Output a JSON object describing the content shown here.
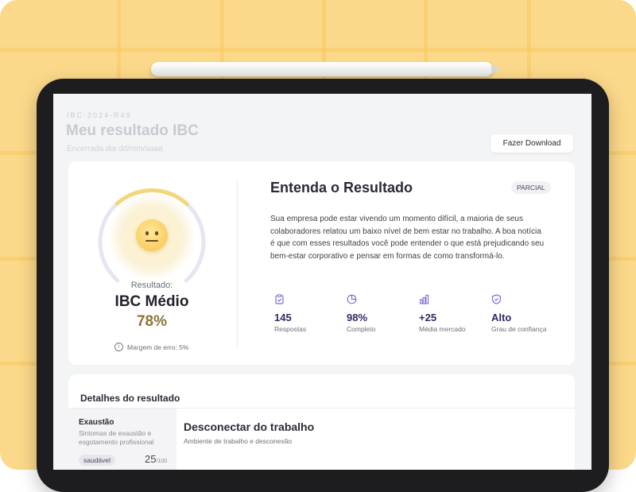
{
  "header": {
    "eyebrow": "IBC-2024-R49",
    "title": "Meu resultado IBC",
    "subtitle": "Encerrada dia dd/mm/aaaa",
    "download_label": "Fazer Download"
  },
  "result": {
    "label": "Resultado:",
    "value": "IBC Médio",
    "percentage": "78%",
    "gauge_fill": 0.78,
    "margin_text": "Margem de erro: 5%"
  },
  "explanation": {
    "title": "Entenda o Resultado",
    "badge": "PARCIAL",
    "description": "Sua empresa pode estar vivendo um momento difícil, a maioria de seus colaboradores relatou um baixo nível de bem estar no trabalho. A boa notícia é que com esses resultados você pode entender o que está prejudicando seu bem-estar corporativo e pensar em formas de como transformá-lo."
  },
  "stats": [
    {
      "icon": "clipboard-check-icon",
      "value": "145",
      "label": "Respostas"
    },
    {
      "icon": "pie-chart-icon",
      "value": "98%",
      "label": "Completo"
    },
    {
      "icon": "bar-chart-icon",
      "value": "+25",
      "label": "Média mercado"
    },
    {
      "icon": "shield-check-icon",
      "value": "Alto",
      "label": "Grau de confiança"
    }
  ],
  "details": {
    "title": "Detalhes do resultado",
    "item": {
      "title": "Exaustão",
      "description": "Sintomas de exaustão e esgotamento profissional",
      "badge": "saudável",
      "score": "25",
      "score_max": "/100"
    },
    "main_title": "Desconectar do trabalho",
    "main_subtitle": "Ambiente de trabalho e desconexão"
  },
  "colors": {
    "background": "#fcd98a",
    "accent_purple": "#7a6fd0",
    "gauge_yellow": "#f5d679",
    "result_gold": "#8a7437"
  }
}
